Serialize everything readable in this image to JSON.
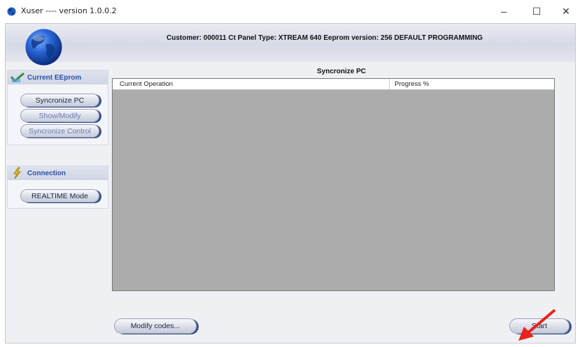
{
  "window": {
    "title": "Xuser ---- version 1.0.0.2",
    "controls": {
      "minimize": "–",
      "maximize": "☐",
      "close": "✕"
    }
  },
  "header": {
    "info": "Customer: 000011 Ct Panel Type: XTREAM 640 Eeprom version: 256  DEFAULT PROGRAMMING"
  },
  "sidebar": {
    "eeprom_panel": {
      "title": "Current EEprom",
      "buttons": [
        {
          "label": "Syncronize PC",
          "enabled": true
        },
        {
          "label": "Show/Modify",
          "enabled": false
        },
        {
          "label": "Syncronize Control",
          "enabled": false
        }
      ]
    },
    "connection_panel": {
      "title": "Connection",
      "buttons": [
        {
          "label": "REALTIME Mode",
          "enabled": true
        }
      ]
    }
  },
  "main": {
    "section_title": "Syncronize PC",
    "columns": [
      "Current Operation",
      "Progress %"
    ],
    "rows": []
  },
  "footer": {
    "modify_codes": "Modify codes...",
    "start": "Start"
  },
  "colors": {
    "accent_shadow": "#3b4f90",
    "panel_title": "#2c4fa8",
    "grid_bg": "#acacac",
    "arrow": "#e8231b"
  }
}
